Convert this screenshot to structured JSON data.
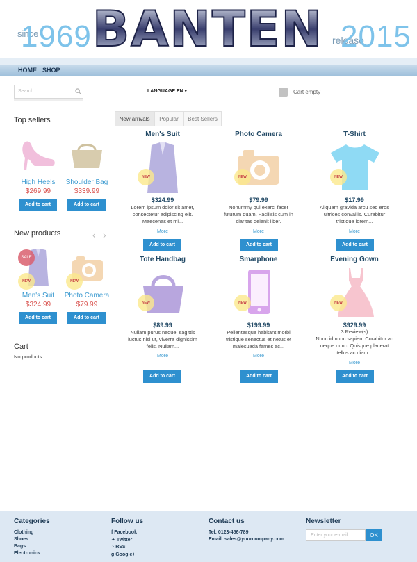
{
  "header": {
    "since": "since",
    "year_left": "1969",
    "brand": "BANTEN",
    "release": "release",
    "year_right": "2015"
  },
  "nav": {
    "home": "HOME",
    "shop": "SHOP"
  },
  "search": {
    "placeholder": "Search"
  },
  "language": {
    "label": "LANGUAGE:",
    "value": "EN"
  },
  "cart_status": "Cart empty",
  "top_sellers": {
    "title": "Top sellers",
    "items": [
      {
        "name": "High Heels",
        "price": "$269.99",
        "button": "Add to cart",
        "icon": "high-heel-icon"
      },
      {
        "name": "Shoulder Bag",
        "price": "$339.99",
        "button": "Add to cart",
        "icon": "shoulder-bag-icon"
      }
    ]
  },
  "new_products": {
    "title": "New products",
    "items": [
      {
        "name": "Men's Suit",
        "price": "$324.99",
        "button": "Add to cart",
        "badge_sale": "SALE",
        "badge_new": "NEW",
        "icon": "suit-icon"
      },
      {
        "name": "Photo Camera",
        "price": "$79.99",
        "button": "Add to cart",
        "badge_new": "NEW",
        "icon": "camera-icon"
      }
    ]
  },
  "cart": {
    "title": "Cart",
    "status": "No products"
  },
  "tabs": [
    "New arrivals",
    "Popular",
    "Best Sellers"
  ],
  "products": [
    {
      "name": "Men's Suit",
      "price": "$324.99",
      "desc": [
        "Lorem ipsum dolor sit amet,",
        "consectetur adipiscing elit.",
        "Maecenas et mi..."
      ],
      "more": "More",
      "button": "Add to cart",
      "badge": "NEW",
      "icon": "suit-icon"
    },
    {
      "name": "Photo Camera",
      "price": "$79.99",
      "desc": [
        "Nonummy qui exerci facer",
        "futurum quam. Facilisis cum in",
        "claritas delenit liber."
      ],
      "more": "More",
      "button": "Add to cart",
      "badge": "NEW",
      "icon": "camera-icon"
    },
    {
      "name": "T-Shirt",
      "price": "$17.99",
      "desc": [
        "Aliquam gravida arcu sed eros",
        "ultrices convallis. Curabitur",
        "tristique lorem..."
      ],
      "more": "More",
      "button": "Add to cart",
      "badge": "NEW",
      "icon": "tshirt-icon"
    },
    {
      "name": "Tote Handbag",
      "price": "$89.99",
      "desc": [
        "Nullam purus neque, sagittis",
        "luctus nisl ut, viverra dignissim",
        "felis. Nullam..."
      ],
      "more": "More",
      "button": "Add to cart",
      "badge": "NEW",
      "icon": "handbag-icon"
    },
    {
      "name": "Smarphone",
      "price": "$199.99",
      "desc": [
        "Pellentesque habitant morbi",
        "tristique senectus et netus et",
        "malesuada fames ac..."
      ],
      "more": "More",
      "button": "Add to cart",
      "badge": "NEW",
      "icon": "smartphone-icon"
    },
    {
      "name": "Evening Gown",
      "price": "$929.99",
      "reviews": "3 Review(s)",
      "desc": [
        "Nunc id nunc sapien. Curabitur ac",
        "neque nunc. Quisque placerat",
        "tellus ac diam..."
      ],
      "more": "More",
      "button": "Add to cart",
      "badge": "NEW",
      "icon": "dress-icon"
    }
  ],
  "footer": {
    "categories": {
      "title": "Categories",
      "links": [
        "Clothing",
        "Shoes",
        "Bags",
        "Electronics"
      ]
    },
    "follow": {
      "title": "Follow us",
      "links": [
        "Facebook",
        "Twitter",
        "RSS",
        "Google+"
      ]
    },
    "contact": {
      "title": "Contact us",
      "tel": "Tel: 0123-456-789",
      "email": "Email: sales@yourcompany.com"
    },
    "newsletter": {
      "title": "Newsletter",
      "placeholder": "Enter your e-mail",
      "button": "OK"
    }
  },
  "colors": {
    "accent": "#2e90cf",
    "price_red": "#d9534f",
    "title_dark": "#234a66"
  }
}
